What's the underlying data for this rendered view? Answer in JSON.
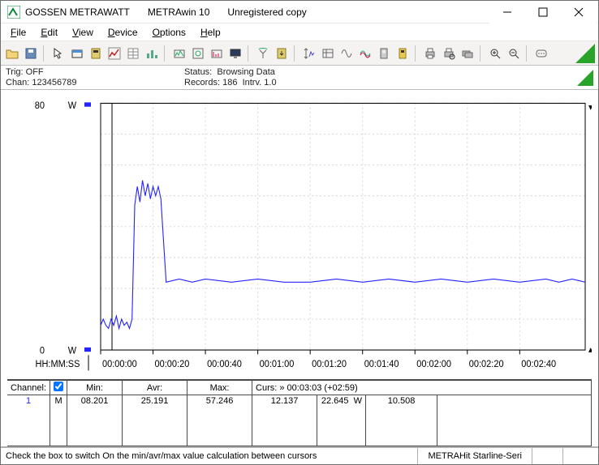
{
  "window": {
    "brand": "GOSSEN METRAWATT",
    "app": "METRAwin 10",
    "registration": "Unregistered copy"
  },
  "menu": {
    "file": "File",
    "edit": "Edit",
    "view": "View",
    "device": "Device",
    "options": "Options",
    "help": "Help"
  },
  "info": {
    "trig_label": "Trig:",
    "trig_value": "OFF",
    "chan_label": "Chan:",
    "chan_value": "123456789",
    "status_label": "Status:",
    "status_value": "Browsing Data",
    "records_label": "Records:",
    "records_value": "186",
    "intrv_label": "Intrv.",
    "intrv_value": "1.0"
  },
  "chart_data": {
    "type": "line",
    "title": "",
    "xlabel": "HH:MM:SS",
    "ylabel_unit": "W",
    "ylim": [
      0,
      80
    ],
    "x_ticks": [
      "00:00:00",
      "00:00:20",
      "00:00:40",
      "00:01:00",
      "00:01:20",
      "00:01:40",
      "00:02:00",
      "00:02:20",
      "00:02:40"
    ],
    "x": [
      0,
      1,
      2,
      3,
      4,
      5,
      6,
      7,
      8,
      9,
      10,
      11,
      12,
      13,
      14,
      15,
      16,
      17,
      18,
      19,
      20,
      21,
      22,
      23,
      25,
      30,
      35,
      40,
      50,
      60,
      70,
      80,
      90,
      100,
      110,
      120,
      130,
      140,
      150,
      160,
      170,
      175,
      180,
      185
    ],
    "values": [
      8,
      10,
      8,
      7,
      10,
      8,
      11,
      7,
      10,
      8,
      9,
      7,
      10,
      47,
      53,
      48,
      55,
      50,
      54,
      49,
      53,
      50,
      53,
      49,
      22,
      23,
      22,
      23,
      22,
      23,
      22,
      22,
      23,
      22,
      23,
      22,
      23,
      22,
      23,
      22,
      23,
      22,
      23,
      22
    ]
  },
  "table": {
    "headers": {
      "channel": "Channel:",
      "min": "Min:",
      "avr": "Avr:",
      "max": "Max:",
      "curs": "Curs: » 00:03:03 (+02:59)"
    },
    "row": {
      "idx": "1",
      "mode": "M",
      "min": "08.201",
      "avr": "25.191",
      "max": "57.246",
      "c1": "12.137",
      "c2": "22.645",
      "unit": "W",
      "c3": "10.508"
    }
  },
  "status": {
    "text": "Check the box to switch On the min/avr/max value calculation between cursors",
    "device": "METRAHit Starline-Seri"
  }
}
